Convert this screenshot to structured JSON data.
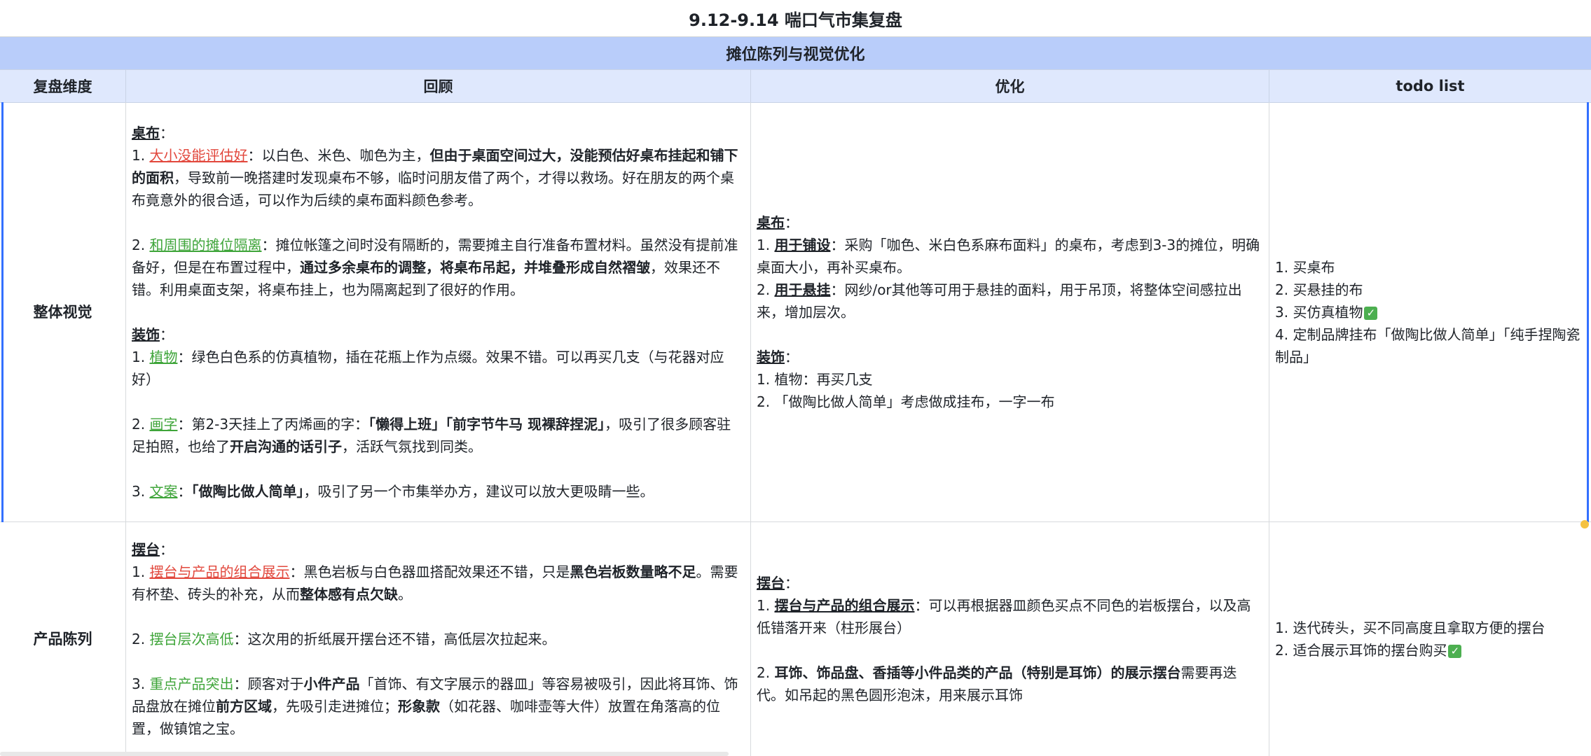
{
  "title": "9.12-9.14 喘口气市集复盘",
  "section": "摊位陈列与视觉优化",
  "headers": [
    "复盘维度",
    "回顾",
    "优化",
    "todo list"
  ],
  "rows": [
    {
      "dimension": "整体视觉",
      "review": [
        [
          {
            "t": "桌布",
            "c": "u"
          },
          {
            "t": "："
          }
        ],
        [
          {
            "t": "1. "
          },
          {
            "t": "大小没能评估好",
            "c": "red"
          },
          {
            "t": "：以白色、米色、咖色为主，"
          },
          {
            "t": "但由于桌面空间过大，没能预估好桌布挂起和铺下的面积",
            "c": "b"
          },
          {
            "t": "，导致前一晚搭建时发现桌布不够，临时问朋友借了两个，才得以救场。好在朋友的两个桌布竟意外的很合适，可以作为后续的桌布面料颜色参考。"
          }
        ],
        [],
        [
          {
            "t": "2. "
          },
          {
            "t": "和周围的摊位隔离",
            "c": "green"
          },
          {
            "t": "：摊位帐篷之间时没有隔断的，需要摊主自行准备布置材料。虽然没有提前准备好，但是在布置过程中，"
          },
          {
            "t": "通过多余桌布的调整，将桌布吊起，并堆叠形成自然褶皱",
            "c": "b"
          },
          {
            "t": "，效果还不错。利用桌面支架，将桌布挂上，也为隔离起到了很好的作用。"
          }
        ],
        [],
        [
          {
            "t": "装饰",
            "c": "u"
          },
          {
            "t": "："
          }
        ],
        [
          {
            "t": "1. "
          },
          {
            "t": "植物",
            "c": "green"
          },
          {
            "t": "：绿色白色系的仿真植物，插在花瓶上作为点缀。效果不错。可以再买几支（与花器对应好）"
          }
        ],
        [],
        [
          {
            "t": "2. "
          },
          {
            "t": "画字",
            "c": "green"
          },
          {
            "t": "：第2-3天挂上了丙烯画的字："
          },
          {
            "t": "「懒得上班」「前字节牛马 现裸辞捏泥」",
            "c": "b"
          },
          {
            "t": "，吸引了很多顾客驻足拍照，也给了"
          },
          {
            "t": "开启沟通的话引子",
            "c": "b"
          },
          {
            "t": "，活跃气氛找到同类。"
          }
        ],
        [],
        [
          {
            "t": "3. "
          },
          {
            "t": "文案",
            "c": "green"
          },
          {
            "t": "："
          },
          {
            "t": "「做陶比做人简单」",
            "c": "b"
          },
          {
            "t": "，吸引了另一个市集举办方，建议可以放大更吸睛一些。"
          }
        ]
      ],
      "optimize": [
        [
          {
            "t": "桌布",
            "c": "u"
          },
          {
            "t": "："
          }
        ],
        [
          {
            "t": "1. "
          },
          {
            "t": "用于铺设",
            "c": "u"
          },
          {
            "t": "：采购「咖色、米白色系麻布面料」的桌布，考虑到3-3的摊位，明确桌面大小，再补买桌布。"
          }
        ],
        [
          {
            "t": "2. "
          },
          {
            "t": "用于悬挂",
            "c": "u"
          },
          {
            "t": "：网纱/or其他等可用于悬挂的面料，用于吊顶，将整体空间感拉出来，增加层次。"
          }
        ],
        [],
        [
          {
            "t": "装饰",
            "c": "u"
          },
          {
            "t": "："
          }
        ],
        [
          {
            "t": "1. 植物：再买几支"
          }
        ],
        [
          {
            "t": "2. 「做陶比做人简单」考虑做成挂布，一字一布"
          }
        ]
      ],
      "todo": [
        [
          {
            "t": "1. 买桌布"
          }
        ],
        [
          {
            "t": "2. 买悬挂的布"
          }
        ],
        [
          {
            "t": "3. 买仿真植物"
          },
          {
            "check": true
          }
        ],
        [
          {
            "t": "4. 定制品牌挂布「做陶比做人简单」「纯手捏陶瓷制品」"
          }
        ]
      ]
    },
    {
      "dimension": "产品陈列",
      "review": [
        [
          {
            "t": "摆台",
            "c": "u"
          },
          {
            "t": "："
          }
        ],
        [
          {
            "t": "1. "
          },
          {
            "t": "摆台与产品的组合展示",
            "c": "red"
          },
          {
            "t": "：黑色岩板与白色器皿搭配效果还不错，只是"
          },
          {
            "t": "黑色岩板数量略不足",
            "c": "b"
          },
          {
            "t": "。需要有杯垫、砖头的补充，从而"
          },
          {
            "t": "整体感有点欠缺",
            "c": "b"
          },
          {
            "t": "。"
          }
        ],
        [],
        [
          {
            "t": "2. "
          },
          {
            "t": "摆台层次高低",
            "c": "greenp"
          },
          {
            "t": "：这次用的折纸展开摆台还不错，高低层次拉起来。"
          }
        ],
        [],
        [
          {
            "t": "3. "
          },
          {
            "t": "重点产品突出",
            "c": "greenp"
          },
          {
            "t": "：顾客对于"
          },
          {
            "t": "小件产品",
            "c": "b"
          },
          {
            "t": "「首饰、有文字展示的器皿」等容易被吸引，因此将耳饰、饰品盘放在摊位"
          },
          {
            "t": "前方区域",
            "c": "b"
          },
          {
            "t": "，先吸引走进摊位；"
          },
          {
            "t": "形象款",
            "c": "b"
          },
          {
            "t": "（如花器、咖啡壶等大件）放置在角落高的位置，做镇馆之宝。"
          }
        ]
      ],
      "optimize": [
        [
          {
            "t": "摆台",
            "c": "u"
          },
          {
            "t": "："
          }
        ],
        [
          {
            "t": "1. "
          },
          {
            "t": "摆台与产品的组合展示",
            "c": "u"
          },
          {
            "t": "：可以再根据器皿颜色买点不同色的岩板摆台，以及高低错落开来（柱形展台）"
          }
        ],
        [],
        [
          {
            "t": "2. "
          },
          {
            "t": "耳饰、饰品盘、香插等小件品类的产品（特别是耳饰）的展示摆台",
            "c": "b"
          },
          {
            "t": "需要再迭代。如吊起的黑色圆形泡沫，用来展示耳饰"
          }
        ]
      ],
      "todo": [
        [
          {
            "t": "1. 迭代砖头，买不同高度且拿取方便的摆台"
          }
        ],
        [
          {
            "t": "2. 适合展示耳饰的摆台购买"
          },
          {
            "check": true
          }
        ]
      ]
    }
  ],
  "colors": {
    "section_bg": "#b9cdfa",
    "header_bg": "#dfe8fd",
    "red_text": "#e2483d",
    "green_text": "#3fa53a",
    "selection": "#3370ff",
    "check": "#4caf50"
  },
  "icons": {
    "check": "check-mark-icon",
    "check_glyph": "✓"
  }
}
